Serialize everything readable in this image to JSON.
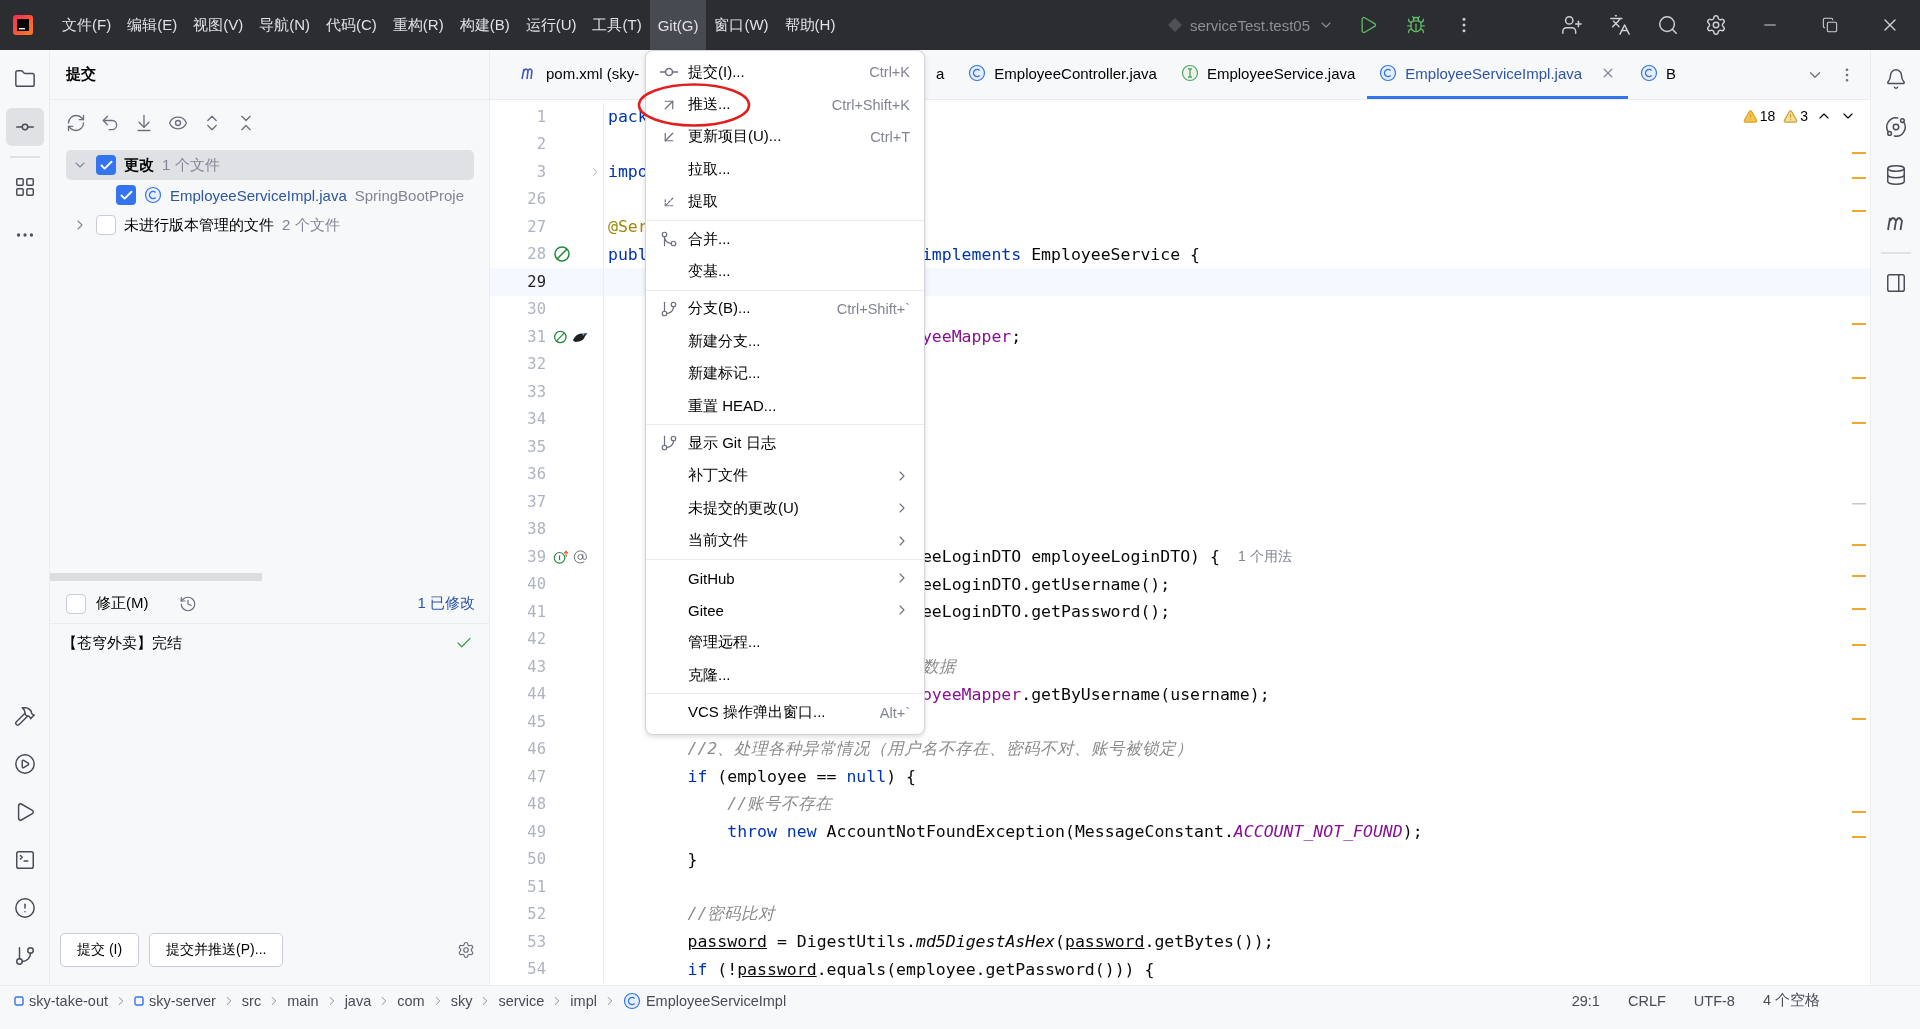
{
  "menubar": {
    "items": [
      {
        "label": "文件(F)",
        "selected": false
      },
      {
        "label": "编辑(E)",
        "selected": false
      },
      {
        "label": "视图(V)",
        "selected": false
      },
      {
        "label": "导航(N)",
        "selected": false
      },
      {
        "label": "代码(C)",
        "selected": false
      },
      {
        "label": "重构(R)",
        "selected": false
      },
      {
        "label": "构建(B)",
        "selected": false
      },
      {
        "label": "运行(U)",
        "selected": false
      },
      {
        "label": "工具(T)",
        "selected": false
      },
      {
        "label": "Git(G)",
        "selected": true
      },
      {
        "label": "窗口(W)",
        "selected": false
      },
      {
        "label": "帮助(H)",
        "selected": false
      }
    ],
    "run_config": "serviceTest.test05"
  },
  "commit_panel": {
    "title": "提交",
    "tree": [
      {
        "label": "更改",
        "count": "1 个文件",
        "checked": true,
        "expanded": true,
        "selected": true,
        "children": [
          {
            "label": "EmployeeServiceImpl.java",
            "detail": "SpringBootProje",
            "checked": true
          }
        ]
      },
      {
        "label": "未进行版本管理的文件",
        "count": "2 个文件",
        "checked": false,
        "expanded": false,
        "selected": false
      }
    ],
    "amend": {
      "label": "修正(M)",
      "checked": false
    },
    "modified_link": "1 已修改",
    "message": "【苍穹外卖】完结",
    "buttons": [
      "提交 (I)",
      "提交并推送(P)..."
    ]
  },
  "tabs": [
    {
      "label": "pom.xml (sky-",
      "kind": "maven",
      "selected": false
    },
    {
      "label": "a",
      "kind": "none",
      "selected": false
    },
    {
      "label": "EmployeeController.java",
      "kind": "class",
      "selected": false
    },
    {
      "label": "EmployeeService.java",
      "kind": "interface",
      "selected": false
    },
    {
      "label": "EmployeeServiceImpl.java",
      "kind": "class",
      "selected": true
    },
    {
      "label": "B",
      "kind": "class",
      "selected": false
    }
  ],
  "inspections": {
    "warnings": "18",
    "weak_warnings": "3"
  },
  "code_lines": [
    {
      "number": "1",
      "code": [
        {
          "kind": "kw",
          "text": "pack"
        }
      ]
    },
    {
      "number": "2"
    },
    {
      "number": "3",
      "folded": true,
      "code": [
        {
          "kind": "kw",
          "text": "impo"
        }
      ]
    },
    {
      "number": "26"
    },
    {
      "number": "27",
      "code": [
        {
          "kind": "ann",
          "text": "@Ser"
        }
      ]
    },
    {
      "number": "28",
      "markers": [
        {
          "kind": "bean"
        }
      ],
      "code": [
        {
          "kind": "kw",
          "text": "publ"
        }
      ],
      "right": [
        {
          "kind": "kw",
          "text": "implements"
        },
        {
          "kind": "plain",
          "text": " EmployeeService {"
        }
      ]
    },
    {
      "number": "29",
      "current": true
    },
    {
      "number": "30"
    },
    {
      "number": "31",
      "markers": [
        {
          "kind": "bean"
        },
        {
          "kind": "mapper"
        }
      ],
      "right": [
        {
          "kind": "field",
          "text": "yeeMapper"
        },
        {
          "kind": "plain",
          "text": ";"
        }
      ]
    },
    {
      "number": "32"
    },
    {
      "number": "33"
    },
    {
      "number": "34"
    },
    {
      "number": "35"
    },
    {
      "number": "36"
    },
    {
      "number": "37"
    },
    {
      "number": "38"
    },
    {
      "number": "39",
      "markers": [
        {
          "kind": "implements"
        },
        {
          "kind": "at"
        }
      ],
      "right": [
        {
          "kind": "plain",
          "text": "eeLoginDTO employeeLoginDTO) {"
        }
      ],
      "hint": "1 个用法"
    },
    {
      "number": "40",
      "right": [
        {
          "kind": "plain",
          "text": "eeLoginDTO.getUsername();"
        }
      ]
    },
    {
      "number": "41",
      "right": [
        {
          "kind": "plain",
          "text": "eeLoginDTO.getPassword();"
        }
      ]
    },
    {
      "number": "42"
    },
    {
      "number": "43",
      "right": [
        {
          "kind": "comment",
          "text": "数据"
        }
      ]
    },
    {
      "number": "44",
      "right": [
        {
          "kind": "field",
          "text": "oyeeMapper"
        },
        {
          "kind": "plain",
          "text": ".getByUsername(username);"
        }
      ]
    },
    {
      "number": "45"
    },
    {
      "number": "46",
      "code": [
        {
          "kind": "comment",
          "text": "        //2、处理各种异常情况（用户名不存在、密码不对、账号被锁定）"
        }
      ]
    },
    {
      "number": "47",
      "code": [
        {
          "kind": "kw",
          "text": "        if"
        },
        {
          "kind": "plain",
          "text": " (employee == "
        },
        {
          "kind": "kw",
          "text": "null"
        },
        {
          "kind": "plain",
          "text": ") {"
        }
      ]
    },
    {
      "number": "48",
      "code": [
        {
          "kind": "comment",
          "text": "            //账号不存在"
        }
      ]
    },
    {
      "number": "49",
      "code": [
        {
          "kind": "kw",
          "text": "            throw new"
        },
        {
          "kind": "plain",
          "text": " AccountNotFoundException(MessageConstant."
        },
        {
          "kind": "const",
          "text": "ACCOUNT_NOT_FOUND"
        },
        {
          "kind": "plain",
          "text": ");"
        }
      ]
    },
    {
      "number": "50",
      "code": [
        {
          "kind": "plain",
          "text": "        }"
        }
      ]
    },
    {
      "number": "51"
    },
    {
      "number": "52",
      "code": [
        {
          "kind": "comment",
          "text": "        //密码比对"
        }
      ]
    },
    {
      "number": "53",
      "code": [
        {
          "kind": "var",
          "text": "        password"
        },
        {
          "kind": "plain",
          "text": " = DigestUtils."
        },
        {
          "kind": "static",
          "text": "md5DigestAsHex"
        },
        {
          "kind": "plain",
          "text": "("
        },
        {
          "kind": "var",
          "text": "password"
        },
        {
          "kind": "plain",
          "text": ".getBytes());"
        }
      ]
    },
    {
      "number": "54",
      "code": [
        {
          "kind": "kw",
          "text": "        if"
        },
        {
          "kind": "plain",
          "text": " (!"
        },
        {
          "kind": "var",
          "text": "password"
        },
        {
          "kind": "plain",
          "text": ".equals(employee.getPassword())) {"
        }
      ]
    }
  ],
  "git_menu": [
    {
      "kind": "item",
      "label": "提交(I)...",
      "shortcut": "Ctrl+K"
    },
    {
      "kind": "item",
      "label": "推送...",
      "shortcut": "Ctrl+Shift+K",
      "circled": true
    },
    {
      "kind": "item",
      "label": "更新项目(U)...",
      "shortcut": "Ctrl+T"
    },
    {
      "kind": "item",
      "label": "拉取..."
    },
    {
      "kind": "item",
      "label": "提取"
    },
    {
      "kind": "separator"
    },
    {
      "kind": "item",
      "label": "合并..."
    },
    {
      "kind": "item",
      "label": "变基..."
    },
    {
      "kind": "separator"
    },
    {
      "kind": "item",
      "label": "分支(B)...",
      "shortcut": "Ctrl+Shift+`"
    },
    {
      "kind": "item",
      "label": "新建分支..."
    },
    {
      "kind": "item",
      "label": "新建标记..."
    },
    {
      "kind": "item",
      "label": "重置 HEAD..."
    },
    {
      "kind": "separator"
    },
    {
      "kind": "item",
      "label": "显示 Git 日志"
    },
    {
      "kind": "item",
      "label": "补丁文件",
      "submenu": true
    },
    {
      "kind": "item",
      "label": "未提交的更改(U)",
      "submenu": true
    },
    {
      "kind": "item",
      "label": "当前文件",
      "submenu": true
    },
    {
      "kind": "separator"
    },
    {
      "kind": "item",
      "label": "GitHub",
      "submenu": true
    },
    {
      "kind": "item",
      "label": "Gitee",
      "submenu": true
    },
    {
      "kind": "item",
      "label": "管理远程..."
    },
    {
      "kind": "item",
      "label": "克隆..."
    },
    {
      "kind": "separator"
    },
    {
      "kind": "item",
      "label": "VCS 操作弹出窗口...",
      "shortcut": "Alt+`"
    }
  ],
  "status_bar": {
    "breadcrumbs": [
      {
        "label": "sky-take-out",
        "kind": "module"
      },
      {
        "label": "sky-server",
        "kind": "module"
      },
      {
        "label": "src",
        "kind": "folder"
      },
      {
        "label": "main",
        "kind": "folder"
      },
      {
        "label": "java",
        "kind": "folder"
      },
      {
        "label": "com",
        "kind": "folder"
      },
      {
        "label": "sky",
        "kind": "folder"
      },
      {
        "label": "service",
        "kind": "folder"
      },
      {
        "label": "impl",
        "kind": "folder"
      },
      {
        "label": "EmployeeServiceImpl",
        "kind": "class"
      }
    ],
    "info": [
      "29:1",
      "CRLF",
      "UTF-8",
      "4 个空格"
    ]
  }
}
